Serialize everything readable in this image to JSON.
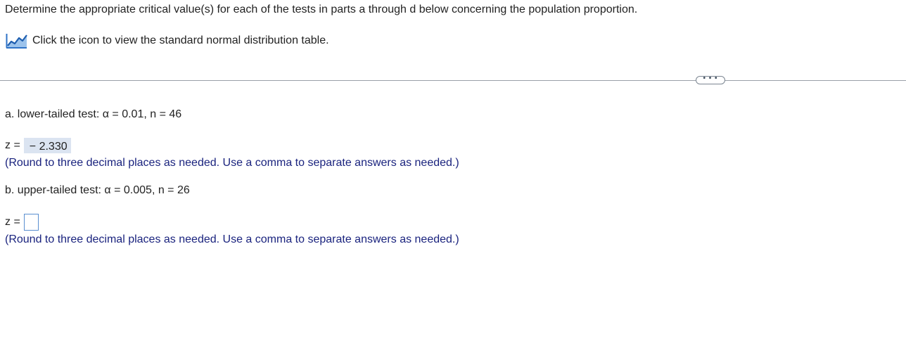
{
  "question": {
    "prompt": "Determine the appropriate critical value(s) for each of the tests in parts a through d below concerning the population proportion."
  },
  "table_link": {
    "icon": "chart-line-icon",
    "label": "Click the icon to view the standard normal distribution table."
  },
  "more_button": {
    "icon": "ellipsis-icon",
    "label": "• • •"
  },
  "parts": [
    {
      "label": "a. lower-tailed test: α = 0.01, n = 46",
      "answer_label": "z =",
      "answer_value": "− 2.330",
      "hint": "(Round to three decimal places as needed. Use a comma to separate answers as needed.)"
    },
    {
      "label": "b. upper-tailed test: α = 0.005, n = 26",
      "answer_label": "z =",
      "answer_value": "",
      "hint": "(Round to three decimal places as needed. Use a comma to separate answers as needed.)"
    }
  ],
  "colors": {
    "hint_text": "#1a237e",
    "answer_fill": "#dbe4f1",
    "input_border": "#5a8fd0",
    "icon_blue": "#2f73c7"
  }
}
